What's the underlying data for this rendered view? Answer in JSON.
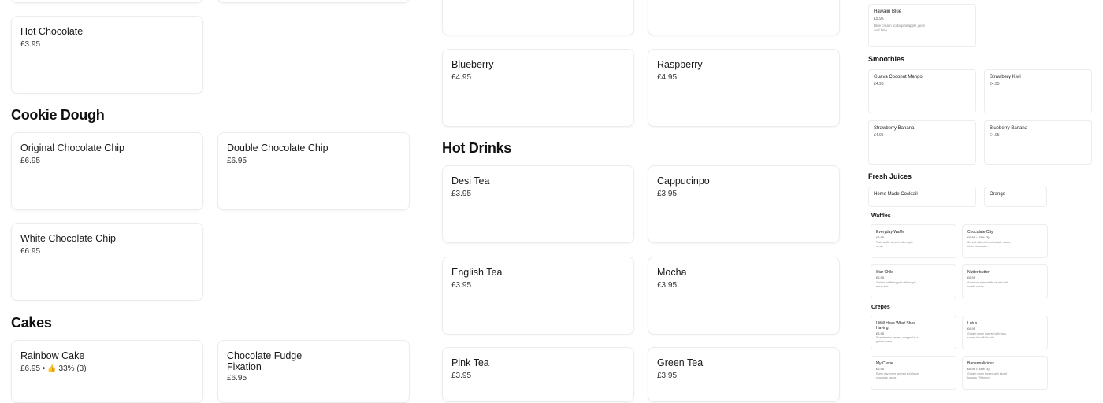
{
  "left_col": {
    "hot_chocolate": {
      "name": "Hot Chocolate",
      "price": "£3.95"
    },
    "cookie_dough": {
      "heading": "Cookie Dough",
      "items": [
        {
          "name": "Original Chocolate Chip",
          "price": "£6.95"
        },
        {
          "name": "Double Chocolate Chip",
          "price": "£6.95"
        },
        {
          "name": "White Chocolate Chip",
          "price": "£6.95"
        }
      ]
    },
    "cakes": {
      "heading": "Cakes",
      "items": [
        {
          "name": "Rainbow Cake",
          "price": "£6.95 •",
          "rating": "33% (3)"
        },
        {
          "name": "Chocolate Fudge Fixation",
          "price": "£6.95"
        }
      ]
    }
  },
  "mid_col": {
    "top_items": [
      {
        "name": "Blueberry",
        "price": "£4.95"
      },
      {
        "name": "Raspberry",
        "price": "£4.95"
      }
    ],
    "hot_drinks": {
      "heading": "Hot Drinks",
      "items": [
        {
          "name": "Desi Tea",
          "price": "£3.95"
        },
        {
          "name": "Cappucinpo",
          "price": "£3.95"
        },
        {
          "name": "English Tea",
          "price": "£3.95"
        },
        {
          "name": "Mocha",
          "price": "£3.95"
        },
        {
          "name": "Pink Tea",
          "price": "£3.95"
        },
        {
          "name": "Green Tea",
          "price": "£3.95"
        }
      ]
    }
  },
  "right_col": {
    "hawaiin": {
      "name": "Hawaiin Blue",
      "price": "£5.95",
      "desc": "Blue cream soda pineapple juice and lime."
    },
    "smoothies": {
      "heading": "Smoothies",
      "items": [
        {
          "name": "Guava Coconut Mango",
          "price": "£4.95"
        },
        {
          "name": "Strawbery Kiwi",
          "price": "£4.95"
        },
        {
          "name": "Strawberry Banana",
          "price": "£4.95"
        },
        {
          "name": "Blueberry Banana",
          "price": "£4.95"
        }
      ]
    },
    "fresh_juices": {
      "heading": "Fresh Juices",
      "items": [
        {
          "name": "Home Made Cocktail"
        },
        {
          "name": "Orange"
        }
      ]
    },
    "waffles": {
      "heading": "Waffles",
      "items": [
        {
          "name": "Everyday Waffle",
          "price": "£6.95",
          "desc": "Plain waffle served with maple syrup."
        },
        {
          "name": "Chocolate City",
          "price": "£6.95 • 33% (3)",
          "desc": "Served with either chocolate sauce, white chocolate..."
        },
        {
          "name": "Star Child",
          "price": "£6.95",
          "desc": "Golden waffle topped with maple syrup and..."
        },
        {
          "name": "Nutter butter",
          "price": "£6.95",
          "desc": "American style waffle served with nutella sauce..."
        }
      ]
    },
    "crepes": {
      "heading": "Crepes",
      "items": [
        {
          "name": "I Will Have What Shes Having",
          "price": "£6.95",
          "desc": "Strawberries banana wrapped in a golden crepe..."
        },
        {
          "name": "Lotus",
          "price": "£6.95",
          "desc": "Golden crepe layered with lotus sauce, biscoff biscuits..."
        },
        {
          "name": "My Crepe",
          "price": "£6.95",
          "desc": "Every day crepe layered in belgium chocolate sauce."
        },
        {
          "name": "Banannalicious",
          "price": "£6.95 • 33% (3)",
          "desc": "Golden crepe topped with sliced banana. Whipped..."
        }
      ]
    }
  }
}
